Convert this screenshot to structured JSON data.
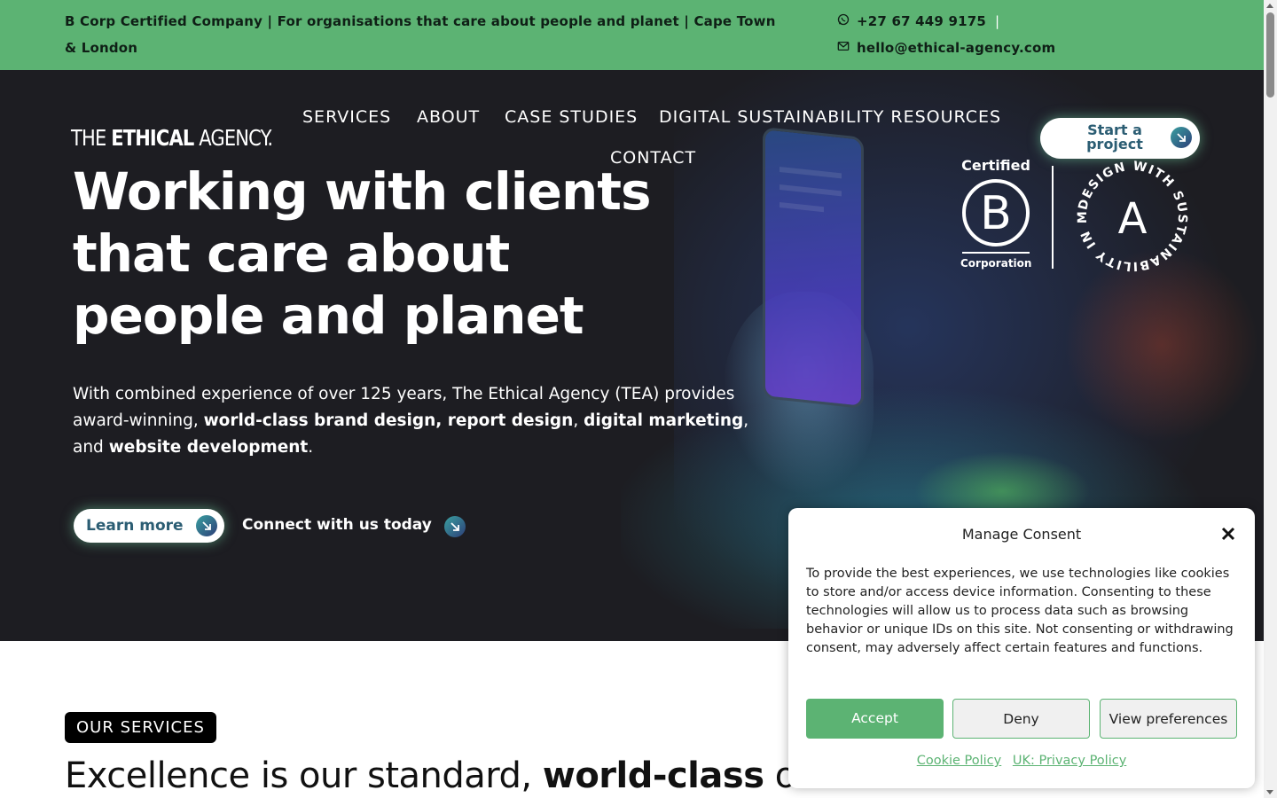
{
  "topbar": {
    "tagline": "B Corp Certified Company | For organisations that care about people and planet | Cape Town & London",
    "phone": "+27 67 449 9175",
    "separator": "|",
    "email": "hello@ethical-agency.com"
  },
  "logo": {
    "part1": "THE ",
    "part2": "ETHICAL",
    "part3": " AGENCY."
  },
  "nav": {
    "items": [
      "SERVICES",
      "ABOUT",
      "CASE STUDIES",
      "DIGITAL SUSTAINABILITY RESOURCES",
      "CONTACT"
    ]
  },
  "cta": {
    "label": "Start a project"
  },
  "badges": {
    "bcorp_top": "Certified",
    "bcorp_letter": "B",
    "bcorp_bottom": "Corporation",
    "dwsim_ring": "DESIGN WITH SUSTAINABILITY IN MIND •",
    "dwsim_letter": "A"
  },
  "hero": {
    "headline": "Working with clients that care about people and planet",
    "intro": [
      {
        "text": "With combined experience of over 125 years, The Ethical Agency (TEA) provides award-winning, ",
        "bold": false
      },
      {
        "text": "world-class brand design, report design",
        "bold": true
      },
      {
        "text": ", ",
        "bold": false
      },
      {
        "text": "digital marketing",
        "bold": true
      },
      {
        "text": ", and ",
        "bold": false
      },
      {
        "text": "website development",
        "bold": true
      },
      {
        "text": ".",
        "bold": false
      }
    ],
    "learn_more": "Learn more",
    "connect": "Connect with us today"
  },
  "services": {
    "pill": "OUR SERVICES",
    "title_part1": "Excellence is our standard, ",
    "title_bold": "world-class",
    "title_part2": " our benchmark"
  },
  "consent": {
    "title": "Manage Consent",
    "body": "To provide the best experiences, we use technologies like cookies to store and/or access device information. Consenting to these technologies will allow us to process data such as browsing behavior or unique IDs on this site. Not consenting or withdrawing consent, may adversely affect certain features and functions.",
    "accept": "Accept",
    "deny": "Deny",
    "preferences": "View preferences",
    "cookie_policy": "Cookie Policy",
    "privacy_policy": "UK: Privacy Policy"
  },
  "colors": {
    "brand_green": "#5cb373",
    "hero_bg": "#1d1d22",
    "cta_text": "#2b5d73"
  }
}
